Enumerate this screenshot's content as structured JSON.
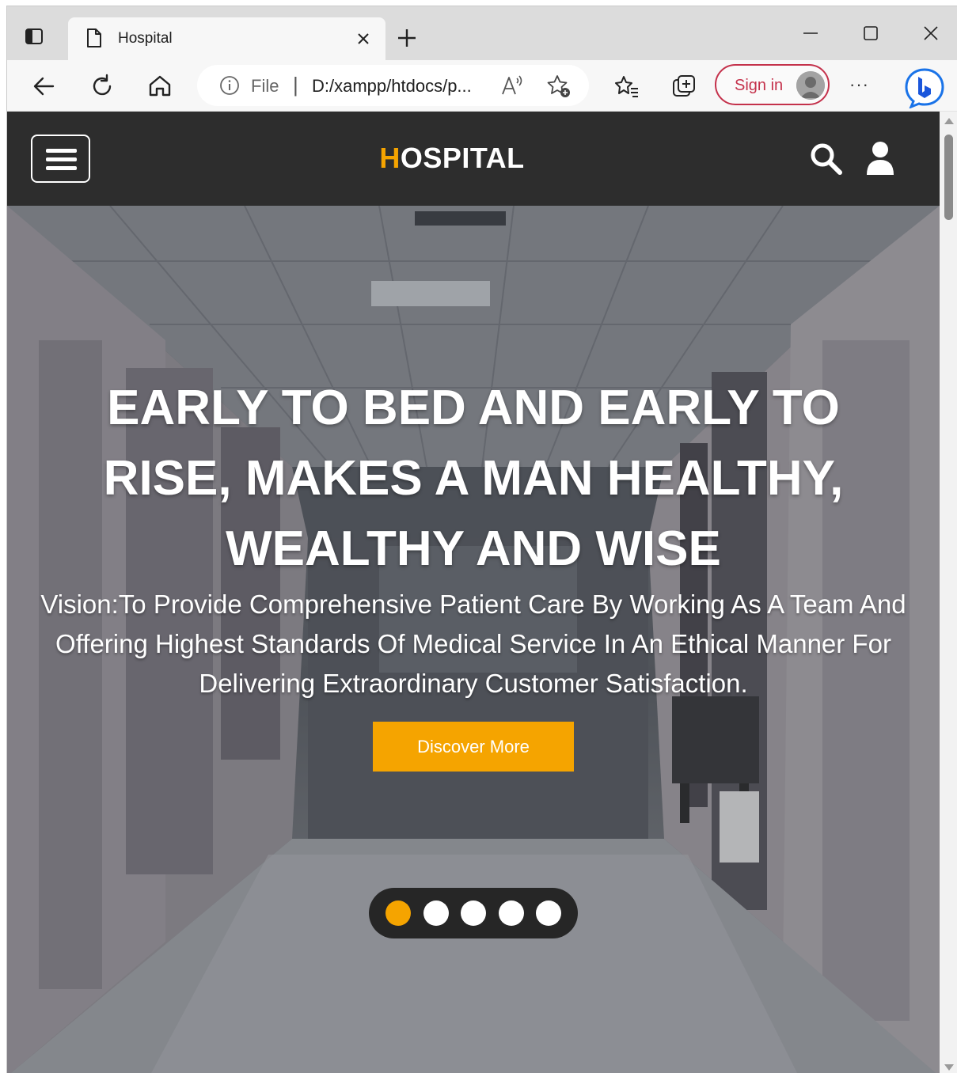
{
  "browser": {
    "tab": {
      "title": "Hospital"
    },
    "address": {
      "scheme_label": "File",
      "url": "D:/xampp/htdocs/p..."
    },
    "sign_in_label": "Sign in",
    "more_label": "···",
    "accent_color": "#c4314b"
  },
  "site": {
    "brand_first": "H",
    "brand_rest": "OSPITAL",
    "brand_accent_color": "#f5a400",
    "navbar_color": "#2d2d2d",
    "hero": {
      "heading": "EARLY TO BED AND EARLY TO RISE, MAKES A MAN HEALTHY, WEALTHY AND WISE",
      "vision": "Vision:To Provide Comprehensive Patient Care By Working As A Team And Offering Highest Standards Of Medical Service In An Ethical Manner For Delivering Extraordinary Customer Satisfaction.",
      "cta_label": "Discover More"
    },
    "carousel": {
      "slide_count": 5,
      "active_index": 0
    }
  },
  "icons": {
    "tab_actions": "tab-actions-icon",
    "page": "page-icon",
    "close": "close-icon",
    "new_tab": "plus-icon",
    "back": "back-arrow-icon",
    "refresh": "refresh-icon",
    "home": "home-icon",
    "info": "info-icon",
    "read_aloud": "read-aloud-icon",
    "add_favorite": "add-favorite-icon",
    "favorites": "favorites-icon",
    "collections": "collections-icon",
    "copilot": "bing-icon",
    "menu": "hamburger-icon",
    "search": "search-icon",
    "user": "user-icon"
  }
}
